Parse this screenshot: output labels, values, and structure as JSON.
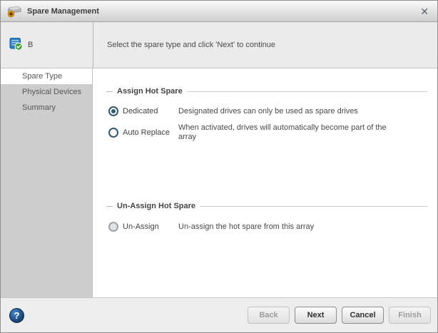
{
  "window": {
    "title": "Spare Management",
    "close_glyph": "✕"
  },
  "header": {
    "device_label": "B",
    "instruction": "Select the spare type and click 'Next' to continue"
  },
  "sidebar": {
    "items": [
      {
        "label": "Spare Type",
        "active": true
      },
      {
        "label": "Physical Devices",
        "active": false
      },
      {
        "label": "Summary",
        "active": false
      }
    ]
  },
  "sections": [
    {
      "title": "Assign Hot Spare",
      "options": [
        {
          "label": "Dedicated",
          "selected": true,
          "enabled": true,
          "description": "Designated drives can only be used as spare drives"
        },
        {
          "label": "Auto Replace",
          "selected": false,
          "enabled": true,
          "description": "When activated, drives will automatically become part of the array"
        }
      ]
    },
    {
      "title": "Un-Assign Hot Spare",
      "options": [
        {
          "label": "Un-Assign",
          "selected": false,
          "enabled": false,
          "description": "Un-assign the hot spare from this array"
        }
      ]
    }
  ],
  "footer": {
    "help_glyph": "?",
    "buttons": [
      {
        "label": "Back",
        "enabled": false
      },
      {
        "label": "Next",
        "enabled": true
      },
      {
        "label": "Cancel",
        "enabled": true
      },
      {
        "label": "Finish",
        "enabled": false
      }
    ]
  },
  "icons": {
    "title_icon": "hard-drive-with-orange-spare-badge",
    "device_icon": "blue-logical-device-with-green-check",
    "help_icon": "blue-question-mark-circle",
    "close_icon": "close-x"
  },
  "colors": {
    "accent_radio": "#33596e",
    "sidebar_gray": "#cdcdcd",
    "band_gray": "#ebebeb",
    "help_blue": "#1c4a80",
    "check_green": "#35a02e",
    "badge_orange": "#f0a018"
  }
}
